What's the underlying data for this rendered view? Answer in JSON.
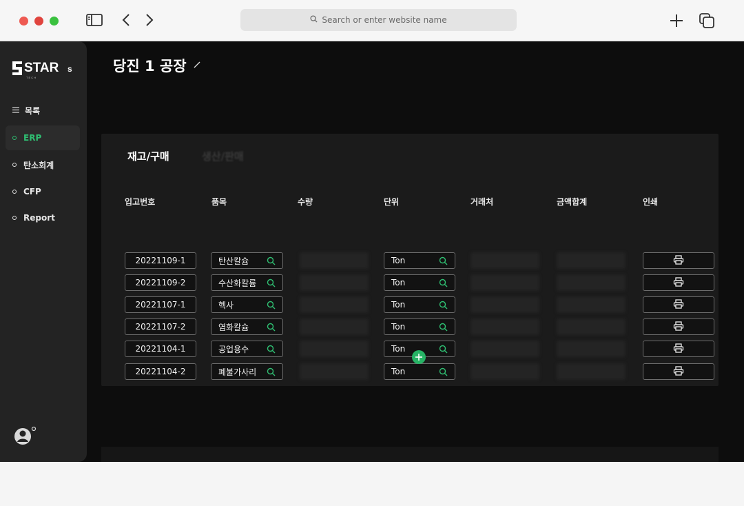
{
  "browser": {
    "url_placeholder": "Search or enter website name",
    "icons": [
      "sidebar-toggle-icon",
      "back-icon",
      "forward-icon",
      "search-icon",
      "plus-icon",
      "tabs-icon"
    ]
  },
  "sidebar": {
    "logo_text": "STAR",
    "logo_suffix": "s",
    "logo_sub": "T E C H",
    "items": [
      {
        "label": "목록",
        "icon": "hamburger-icon",
        "active": false
      },
      {
        "label": "ERP",
        "icon": "bullet-icon",
        "active": true
      },
      {
        "label": "탄소회계",
        "icon": "bullet-icon",
        "active": false
      },
      {
        "label": "CFP",
        "icon": "bullet-icon",
        "active": false
      },
      {
        "label": "Report",
        "icon": "bullet-icon",
        "active": false
      }
    ]
  },
  "main": {
    "title": "당진 1 공장",
    "tabs": [
      {
        "label": "재고/구매",
        "active": true
      },
      {
        "label": "생산/판매",
        "active": false
      }
    ],
    "columns": [
      "입고번호",
      "품목",
      "수량",
      "단위",
      "거래처",
      "금액합계",
      "인쇄"
    ],
    "rows": [
      {
        "code": "20221109-1",
        "item": "탄산칼슘",
        "unit": "Ton"
      },
      {
        "code": "20221109-2",
        "item": "수산화칼륨",
        "unit": "Ton"
      },
      {
        "code": "20221107-1",
        "item": "헥사",
        "unit": "Ton"
      },
      {
        "code": "20221107-2",
        "item": "염화칼슘",
        "unit": "Ton"
      },
      {
        "code": "20221104-1",
        "item": "공업용수",
        "unit": "Ton"
      },
      {
        "code": "20221104-2",
        "item": "폐불가사리",
        "unit": "Ton"
      }
    ]
  },
  "colors": {
    "accent": "#2fbf72",
    "app_bg": "#0d0d0d",
    "panel_bg": "#1b1b1b",
    "sidebar_bg": "#232323"
  }
}
